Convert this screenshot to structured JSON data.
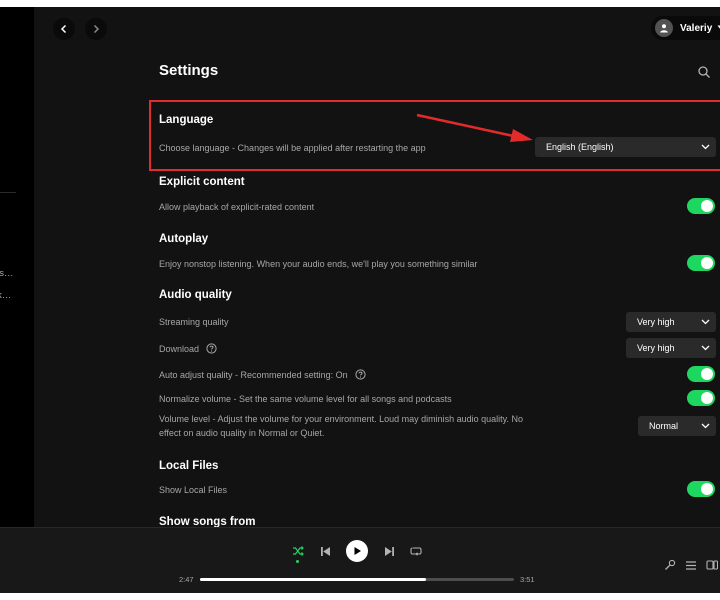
{
  "user": {
    "name": "Valeriy"
  },
  "page": {
    "title": "Settings"
  },
  "sidebar": {
    "snippets": [
      "ns…",
      "rk…"
    ]
  },
  "sections": {
    "language": {
      "title": "Language",
      "description": "Choose language - Changes will be applied after restarting the app",
      "selected": "English (English)"
    },
    "explicit": {
      "title": "Explicit content",
      "description": "Allow playback of explicit-rated content",
      "enabled": true
    },
    "autoplay": {
      "title": "Autoplay",
      "description": "Enjoy nonstop listening. When your audio ends, we'll play you something similar",
      "enabled": true
    },
    "audio_quality": {
      "title": "Audio quality",
      "streaming_label": "Streaming quality",
      "streaming_value": "Very high",
      "download_label": "Download",
      "download_value": "Very high",
      "auto_adjust_label": "Auto adjust quality - Recommended setting: On",
      "auto_adjust_enabled": true,
      "normalize_label": "Normalize volume - Set the same volume level for all songs and podcasts",
      "normalize_enabled": true,
      "volume_level_label": "Volume level - Adjust the volume for your environment. Loud may diminish audio quality. No effect on audio quality in Normal or Quiet.",
      "volume_level_value": "Normal"
    },
    "local_files": {
      "title": "Local Files",
      "show_label": "Show Local Files",
      "enabled": true
    },
    "show_songs_from": {
      "title": "Show songs from"
    }
  },
  "player": {
    "elapsed": "2:47",
    "duration": "3:51",
    "progress_fraction": 0.72,
    "shuffle_active": true
  },
  "colors": {
    "accent_green": "#1ed760",
    "highlight_red": "#e32b2b",
    "background": "#121212"
  },
  "icons": [
    "back-icon",
    "forward-icon",
    "search-icon",
    "help-icon",
    "shuffle-icon",
    "previous-icon",
    "play-icon",
    "next-icon",
    "repeat-icon",
    "mic-icon",
    "queue-icon",
    "devices-icon",
    "chevron-down-icon"
  ]
}
